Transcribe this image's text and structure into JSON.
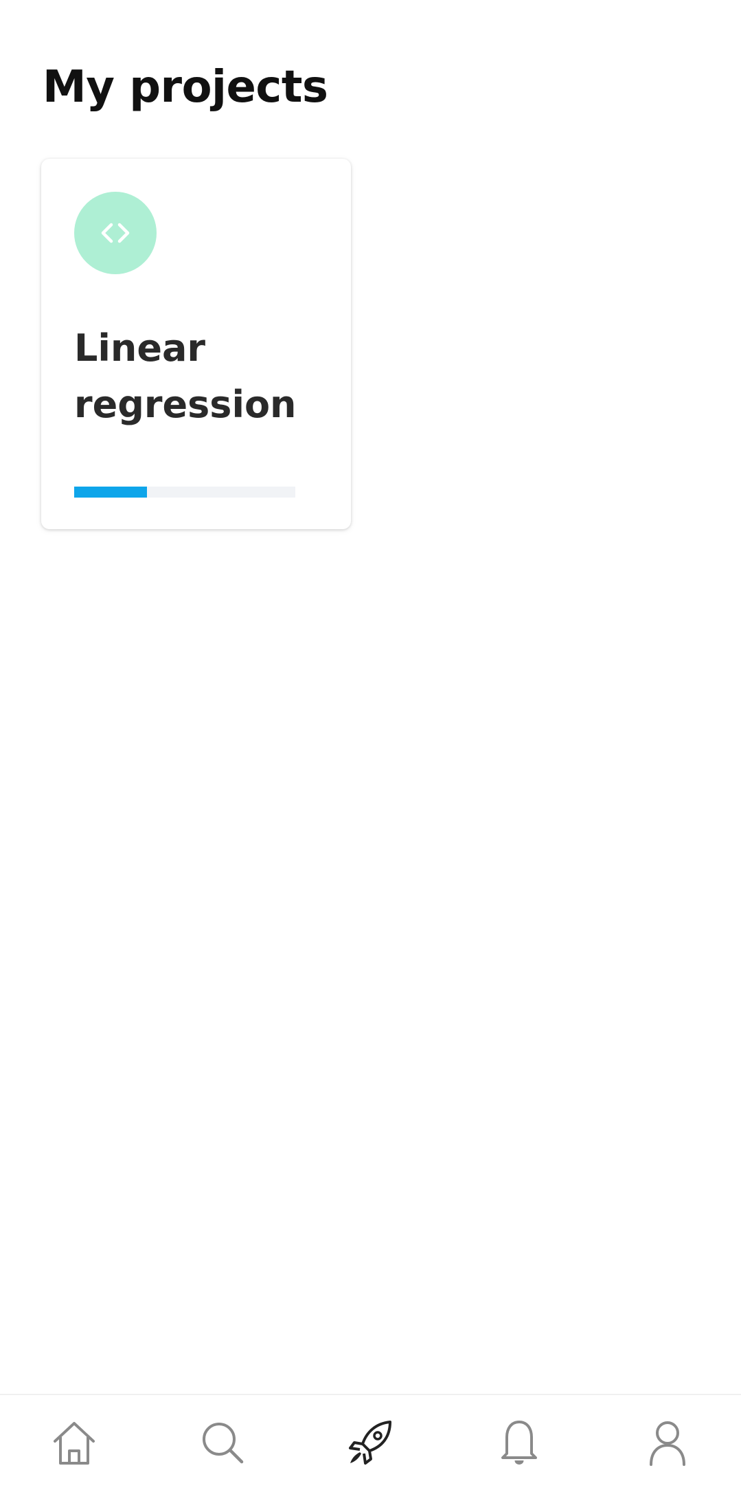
{
  "header": {
    "title": "My projects"
  },
  "projects": [
    {
      "title": "Linear regression",
      "icon": "code-brackets-icon",
      "progress": 0.33,
      "icon_color": "#aeefd4",
      "progress_color": "#0ea5ea"
    }
  ],
  "bottom_nav": {
    "items": [
      {
        "icon": "home-icon",
        "active": false
      },
      {
        "icon": "search-icon",
        "active": false
      },
      {
        "icon": "rocket-icon",
        "active": true
      },
      {
        "icon": "bell-icon",
        "active": false
      },
      {
        "icon": "profile-icon",
        "active": false
      }
    ],
    "active_color": "#222222",
    "inactive_color": "#8a8a8a"
  }
}
